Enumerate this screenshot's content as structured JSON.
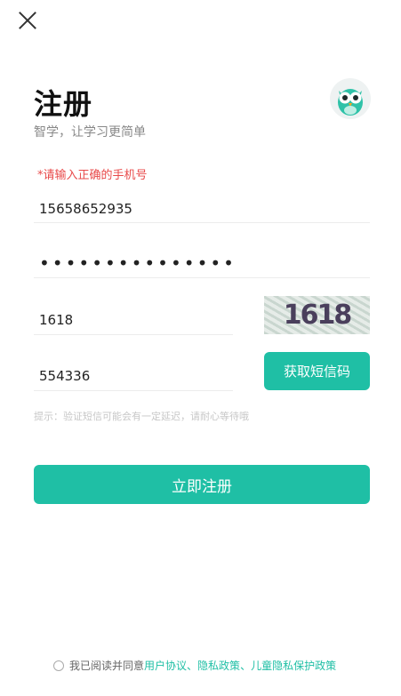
{
  "header": {
    "title": "注册",
    "subtitle": "智学，让学习更简单"
  },
  "form": {
    "error_message": "*请输入正确的手机号",
    "phone_value": "15658652935",
    "password_mask": "•••••••••••••••",
    "captcha_value": "1618",
    "captcha_image_text": "1618",
    "sms_code_value": "554336",
    "sms_button_label": "获取短信码",
    "tip": "提示：验证短信可能会有一定延迟，请耐心等待哦",
    "submit_label": "立即注册"
  },
  "agreement": {
    "prefix": "我已阅读并同意",
    "link_user": "用户协议",
    "sep1": "、",
    "link_privacy": "隐私政策",
    "sep2": "、",
    "link_child": "儿童隐私保护政策"
  },
  "icons": {
    "close": "close-icon",
    "logo": "owl-logo",
    "radio": "radio-icon"
  },
  "colors": {
    "accent": "#1fbfa5",
    "error": "#e84a4a",
    "tip": "#c7c7c7"
  }
}
